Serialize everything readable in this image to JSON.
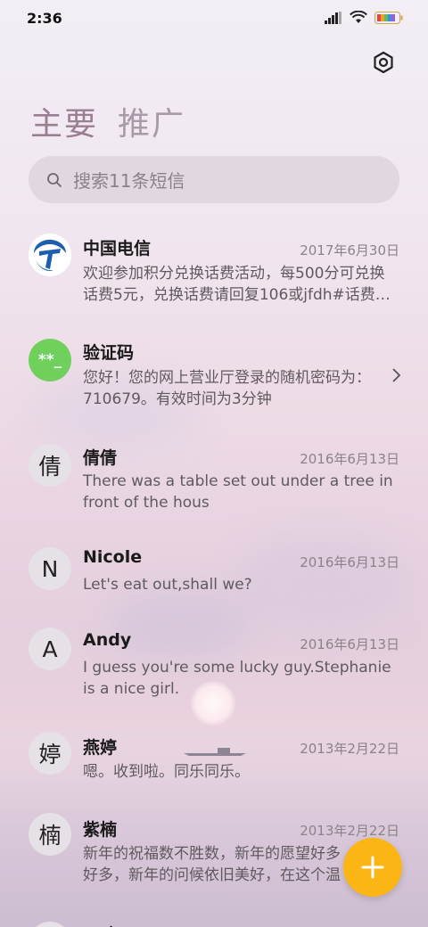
{
  "status_bar": {
    "time": "2:36"
  },
  "tabs": [
    {
      "label": "主要"
    },
    {
      "label": "推广"
    }
  ],
  "search": {
    "placeholder": "搜索11条短信"
  },
  "conversations": [
    {
      "name": "中国电信",
      "date": "2017年6月30日",
      "preview": "欢迎参加积分兑换话费活动，每500分可兑换话费5元，兑换话费请回复106或jfdh#话费…",
      "avatar": ""
    },
    {
      "name": "验证码",
      "date": "",
      "preview": "您好！您的网上营业厅登录的随机密码为：710679。有效时间为3分钟",
      "avatar": "**_"
    },
    {
      "name": "倩倩",
      "date": "2016年6月13日",
      "preview": "There was a table set out under a tree in front of the hous",
      "avatar": "倩"
    },
    {
      "name": "Nicole",
      "date": "2016年6月13日",
      "preview": "Let's eat out,shall we?",
      "avatar": "N"
    },
    {
      "name": "Andy",
      "date": "2016年6月13日",
      "preview": "I guess you're some lucky guy.Stephanie is a nice girl.",
      "avatar": "A"
    },
    {
      "name": "燕婷",
      "date": "2013年2月22日",
      "preview": "嗯。收到啦。同乐同乐。",
      "avatar": "婷"
    },
    {
      "name": "紫楠",
      "date": "2013年2月22日",
      "preview": "新年的祝福数不胜数，新年的愿望好多好多，新年的问候依旧美好，在这个温馨的时",
      "avatar": "楠"
    },
    {
      "name": "子玲",
      "date": "",
      "preview": "",
      "avatar": ""
    }
  ],
  "colors": {
    "accent": "#fbb616",
    "verify_avatar": "#6fd05c",
    "telecom_blue": "#1c5fb0"
  }
}
